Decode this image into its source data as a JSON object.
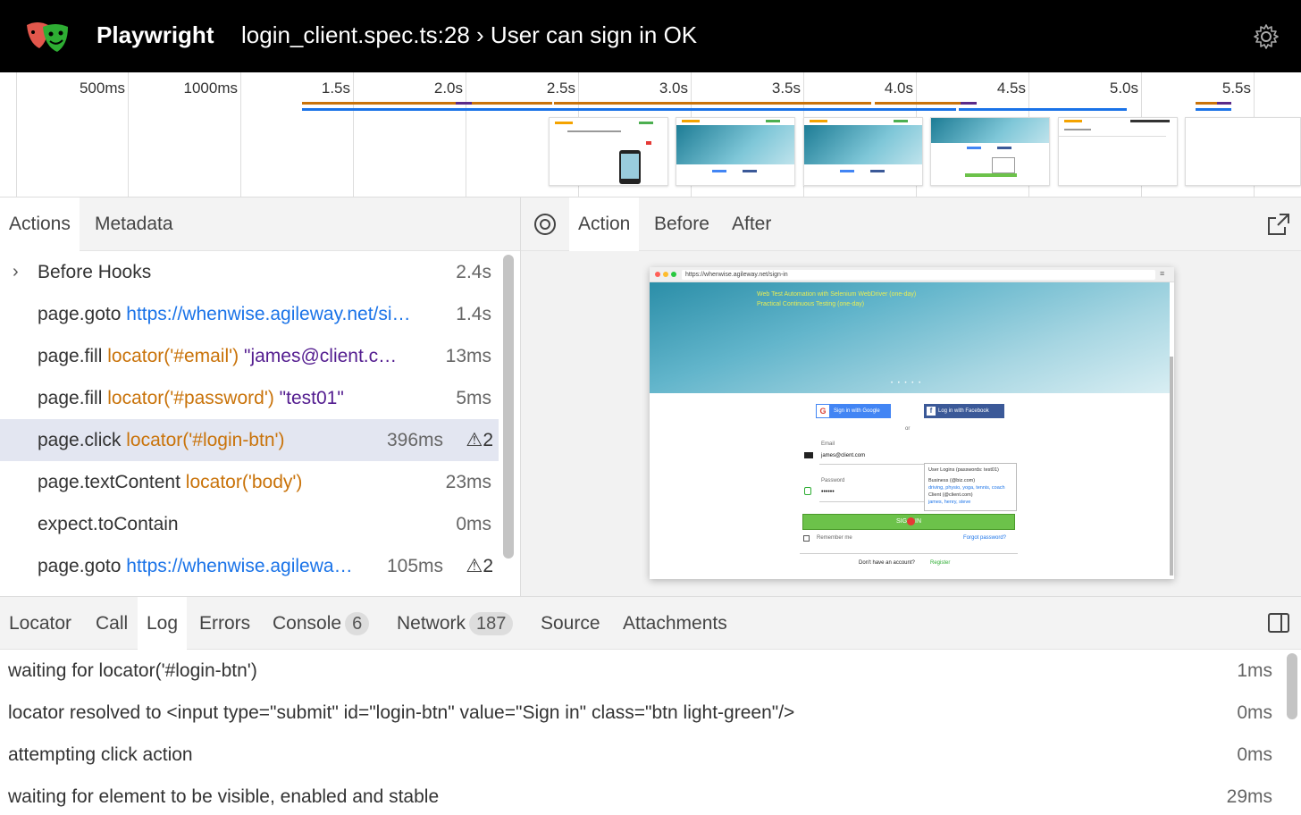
{
  "header": {
    "brand": "Playwright",
    "title": "login_client.spec.ts:28 › User can sign in OK",
    "logo_icon": "playwright-masks-logo",
    "settings_icon": "gear-icon"
  },
  "timeline": {
    "ticks": [
      "500ms",
      "1000ms",
      "1.5s",
      "2.0s",
      "2.5s",
      "3.0s",
      "3.5s",
      "4.0s",
      "4.5s",
      "5.0s",
      "5.5s"
    ]
  },
  "left_tabs": [
    "Actions",
    "Metadata"
  ],
  "actions": [
    {
      "method": "Before Hooks",
      "duration": "2.4s",
      "expandable": true
    },
    {
      "method": "page.goto",
      "url": "https://whenwise.agileway.net/si…",
      "duration": "1.4s"
    },
    {
      "method": "page.fill",
      "locator": "locator('#email')",
      "value": "\"james@client.c…",
      "duration": "13ms"
    },
    {
      "method": "page.fill",
      "locator": "locator('#password')",
      "value": "\"test01\"",
      "duration": "5ms"
    },
    {
      "method": "page.click",
      "locator": "locator('#login-btn')",
      "duration": "396ms",
      "warnings": "2",
      "selected": true
    },
    {
      "method": "page.textContent",
      "locator": "locator('body')",
      "duration": "23ms"
    },
    {
      "method": "expect.toContain",
      "duration": "0ms"
    },
    {
      "method": "page.goto",
      "url": "https://whenwise.agilewa…",
      "duration": "105ms",
      "warnings": "2"
    }
  ],
  "right_tabs": [
    "Action",
    "Before",
    "After"
  ],
  "screenshot": {
    "address": "https://whenwise.agileway.net/sign-in",
    "hero_lines": [
      "Web Test Automation with Selenium WebDriver (one-day)",
      "Practical Continuous Testing (one-day)"
    ],
    "google_button": "Sign in with Google",
    "facebook_button": "Log in with Facebook",
    "or_text": "or",
    "email_label": "Email",
    "email_value": "james@client.com",
    "password_label": "Password",
    "password_value": "••••••",
    "signin_left": "SIG",
    "signin_right": "IN",
    "remember": "Remember me",
    "forgot": "Forgot password?",
    "no_account": "Don't have an account?",
    "register": "Register",
    "tooltip_title": "User Logins (passwords: test01)",
    "tooltip_business_label": "Business",
    "tooltip_business_value": "(@biz.com)",
    "tooltip_business_names": "driving, physio, yoga, tennis, coach",
    "tooltip_client_label": "Client",
    "tooltip_client_value": "(@client.com)",
    "tooltip_client_names": "james, henry, steve"
  },
  "bottom_tabs": {
    "locator": "Locator",
    "call": "Call",
    "log": "Log",
    "errors": "Errors",
    "console": "Console",
    "console_count": "6",
    "network": "Network",
    "network_count": "187",
    "source": "Source",
    "attachments": "Attachments"
  },
  "log": [
    {
      "message": "waiting for locator('#login-btn')",
      "time": "1ms"
    },
    {
      "message": "locator resolved to <input type=\"submit\" id=\"login-btn\" value=\"Sign in\" class=\"btn light-green\"/>",
      "time": "0ms"
    },
    {
      "message": "attempting click action",
      "time": "0ms"
    },
    {
      "message": "waiting for element to be visible, enabled and stable",
      "time": "29ms"
    }
  ],
  "colors": {
    "action_bar": "#c9730a",
    "network_bar": "#1a73e8",
    "selected_row": "#e3e6f1",
    "locator_text": "#c9730a",
    "url_text": "#1a73e8",
    "value_text": "#531c8f"
  }
}
